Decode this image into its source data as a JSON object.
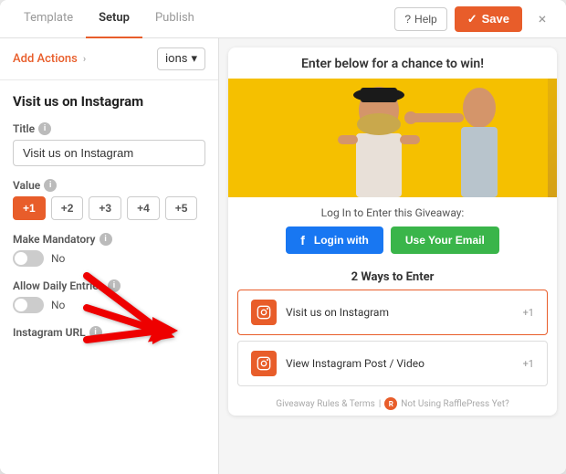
{
  "header": {
    "tab_template": "Template",
    "tab_setup": "Setup",
    "tab_publish": "Publish",
    "help_label": "Help",
    "save_label": "Save",
    "close_icon": "×"
  },
  "left_panel": {
    "add_actions_label": "Add Actions",
    "actions_dropdown_label": "ions",
    "section_title": "Visit us on Instagram",
    "title_field": {
      "label": "Title",
      "value": "Visit us on Instagram"
    },
    "value_field": {
      "label": "Value",
      "buttons": [
        "+1",
        "+2",
        "+3",
        "+4",
        "+5"
      ],
      "active_index": 0
    },
    "mandatory_field": {
      "label": "Make Mandatory",
      "value": "No"
    },
    "daily_entries_field": {
      "label": "Allow Daily Entries",
      "value": "No"
    },
    "instagram_url_field": {
      "label": "Instagram URL"
    }
  },
  "right_panel": {
    "promo_text": "Enter below for a chance to win!",
    "login_text": "Log In to Enter this Giveaway:",
    "fb_btn_label": "Login with",
    "email_btn_label": "Use Your Email",
    "ways_title": "2 Ways to Enter",
    "entries": [
      {
        "label": "Visit us on Instagram",
        "points": "+1",
        "active": true
      },
      {
        "label": "View Instagram Post / Video",
        "points": "+1",
        "active": false
      }
    ],
    "footer_text": "Giveaway Rules & Terms",
    "footer_suffix": "Not Using RafflePress Yet?"
  }
}
